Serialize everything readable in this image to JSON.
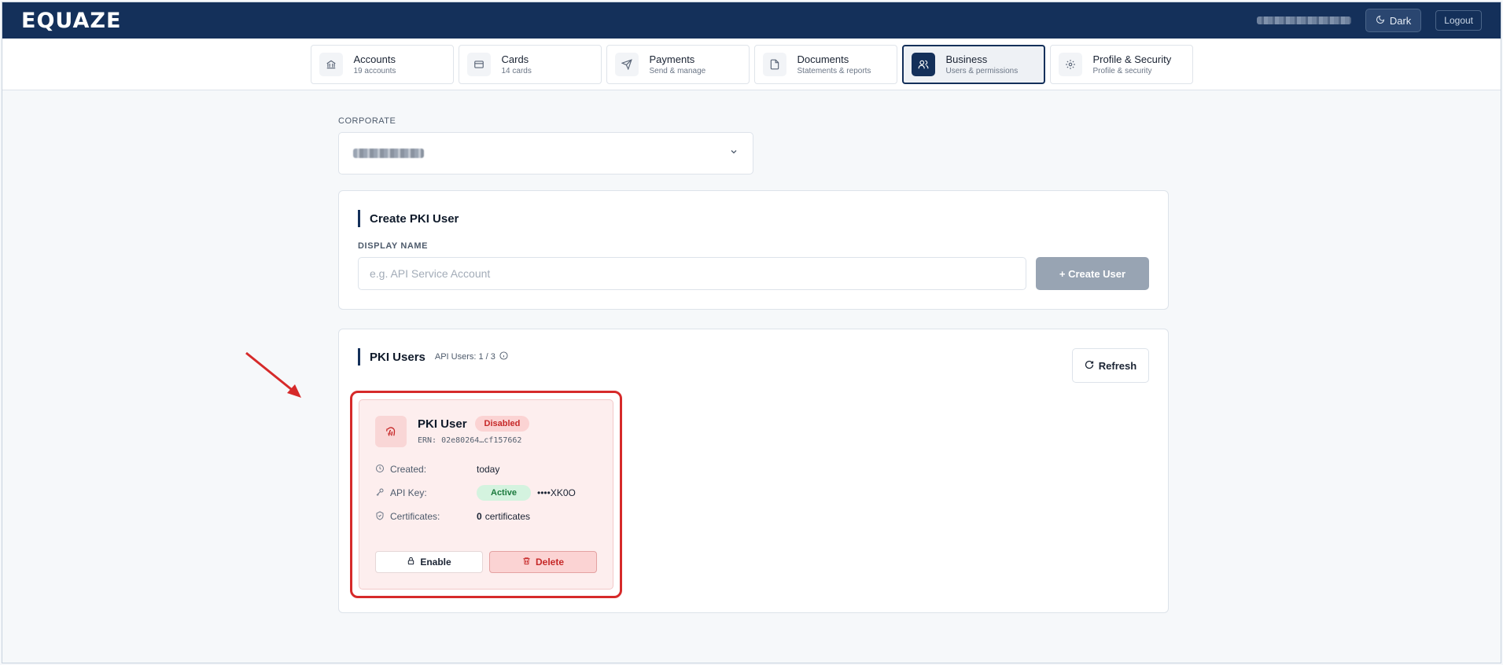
{
  "header": {
    "logo": "EQUAZE",
    "dark_label": "Dark",
    "logout_label": "Logout"
  },
  "nav": {
    "tabs": [
      {
        "label": "Accounts",
        "sub": "19 accounts",
        "icon": "bank-icon"
      },
      {
        "label": "Cards",
        "sub": "14 cards",
        "icon": "card-icon"
      },
      {
        "label": "Payments",
        "sub": "Send & manage",
        "icon": "send-icon"
      },
      {
        "label": "Documents",
        "sub": "Statements & reports",
        "icon": "document-icon"
      },
      {
        "label": "Business",
        "sub": "Users & permissions",
        "icon": "users-icon",
        "active": true
      },
      {
        "label": "Profile & Security",
        "sub": "Profile & security",
        "icon": "gear-icon"
      }
    ]
  },
  "corporate": {
    "label": "CORPORATE"
  },
  "create": {
    "title": "Create PKI User",
    "field_label": "DISPLAY NAME",
    "placeholder": "e.g. API Service Account",
    "value": "",
    "button_label": "+ Create User"
  },
  "pki_users": {
    "title": "PKI Users",
    "count_label": "API Users: 1 / 3",
    "refresh_label": "Refresh",
    "users": [
      {
        "name": "PKI User",
        "status": "Disabled",
        "ern": "ERN: 02e80264…cf157662",
        "created_label": "Created:",
        "created_value": "today",
        "api_key_label": "API Key:",
        "api_key_status": "Active",
        "api_key_masked": "••••XK0O",
        "certs_label": "Certificates:",
        "certs_count": "0",
        "certs_suffix": "certificates",
        "enable_label": "Enable",
        "delete_label": "Delete"
      }
    ]
  },
  "colors": {
    "brand": "#14305a",
    "danger": "#c62828",
    "success": "#1b7a3d",
    "annotation": "#d62a2a"
  }
}
